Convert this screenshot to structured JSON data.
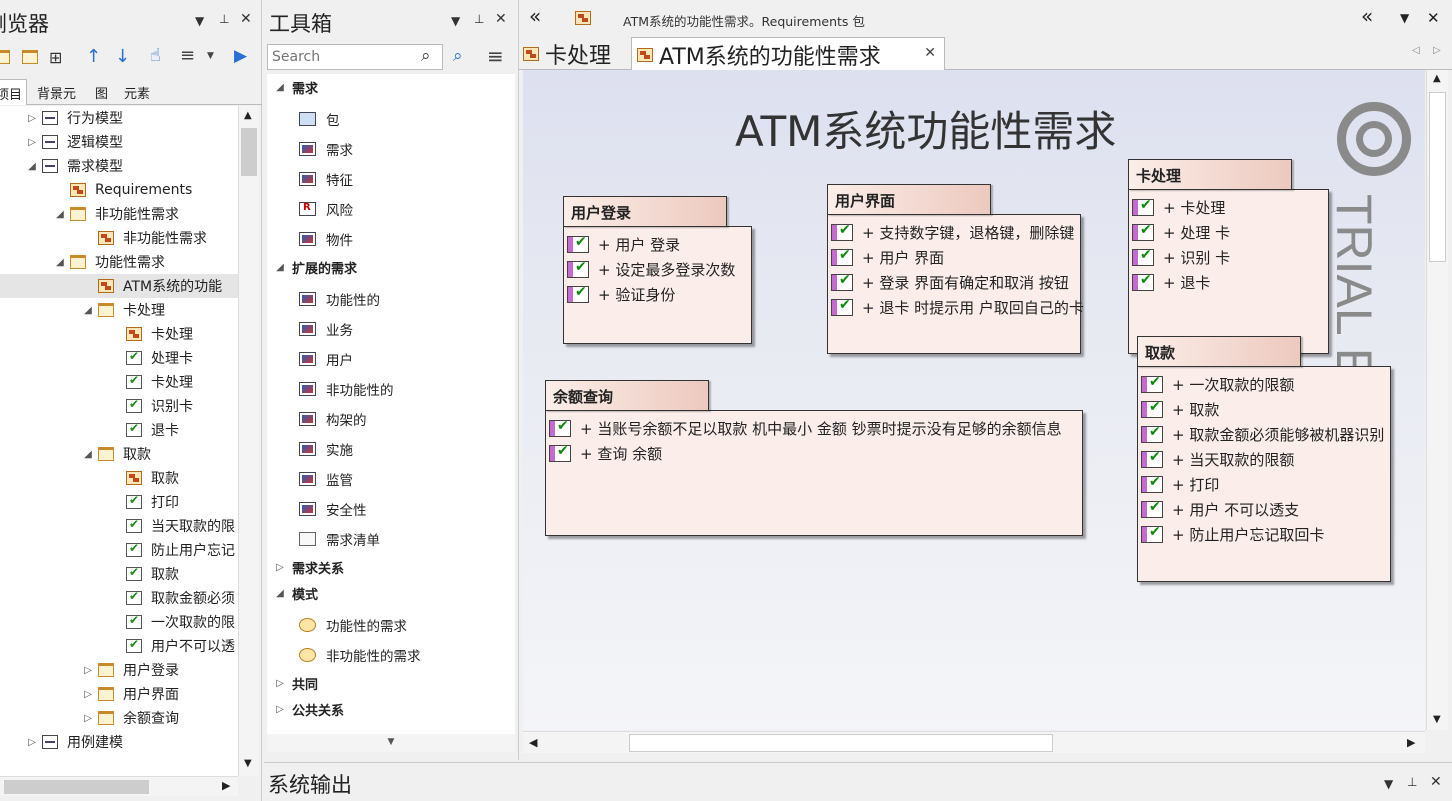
{
  "browser": {
    "title": "浏览器",
    "tabs": [
      "项目",
      "背景元",
      "图",
      "元素"
    ],
    "tree": [
      {
        "label": "行为模型",
        "level": 0,
        "icon": "pkg",
        "tw": "▷"
      },
      {
        "label": "逻辑模型",
        "level": 0,
        "icon": "pkg",
        "tw": "▷"
      },
      {
        "label": "需求模型",
        "level": 0,
        "icon": "pkg",
        "tw": "◢"
      },
      {
        "label": "Requirements",
        "level": 1,
        "icon": "diag",
        "tw": ""
      },
      {
        "label": "非功能性需求",
        "level": 1,
        "icon": "folder",
        "tw": "◢"
      },
      {
        "label": "非功能性需求",
        "level": 2,
        "icon": "diag",
        "tw": ""
      },
      {
        "label": "功能性需求",
        "level": 1,
        "icon": "folder",
        "tw": "◢"
      },
      {
        "label": "ATM系统的功能",
        "level": 2,
        "icon": "diag",
        "tw": "",
        "selected": true
      },
      {
        "label": "卡处理",
        "level": 2,
        "icon": "folder",
        "tw": "◢"
      },
      {
        "label": "卡处理",
        "level": 3,
        "icon": "diag",
        "tw": ""
      },
      {
        "label": "处理卡",
        "level": 3,
        "icon": "req",
        "tw": ""
      },
      {
        "label": "卡处理",
        "level": 3,
        "icon": "req",
        "tw": ""
      },
      {
        "label": "识别卡",
        "level": 3,
        "icon": "req",
        "tw": ""
      },
      {
        "label": "退卡",
        "level": 3,
        "icon": "req",
        "tw": ""
      },
      {
        "label": "取款",
        "level": 2,
        "icon": "folder",
        "tw": "◢"
      },
      {
        "label": "取款",
        "level": 3,
        "icon": "diag",
        "tw": ""
      },
      {
        "label": "打印",
        "level": 3,
        "icon": "req",
        "tw": ""
      },
      {
        "label": "当天取款的限",
        "level": 3,
        "icon": "req",
        "tw": ""
      },
      {
        "label": "防止用户忘记",
        "level": 3,
        "icon": "req",
        "tw": ""
      },
      {
        "label": "取款",
        "level": 3,
        "icon": "req",
        "tw": ""
      },
      {
        "label": "取款金额必须",
        "level": 3,
        "icon": "req",
        "tw": ""
      },
      {
        "label": "一次取款的限",
        "level": 3,
        "icon": "req",
        "tw": ""
      },
      {
        "label": "用户不可以透",
        "level": 3,
        "icon": "req",
        "tw": ""
      },
      {
        "label": "用户登录",
        "level": 2,
        "icon": "folder",
        "tw": "▷"
      },
      {
        "label": "用户界面",
        "level": 2,
        "icon": "folder",
        "tw": "▷"
      },
      {
        "label": "余额查询",
        "level": 2,
        "icon": "folder",
        "tw": "▷"
      },
      {
        "label": "用例建模",
        "level": 0,
        "icon": "pkg",
        "tw": "▷"
      }
    ]
  },
  "toolbox": {
    "title": "工具箱",
    "search_placeholder": "Search",
    "sections": [
      {
        "label": "需求",
        "open": true,
        "items": [
          [
            "包",
            "pkg"
          ],
          [
            "需求",
            "req"
          ],
          [
            "特征",
            "req"
          ],
          [
            "风险",
            "risk"
          ],
          [
            "物件",
            "req"
          ]
        ]
      },
      {
        "label": "扩展的需求",
        "open": true,
        "items": [
          [
            "功能性的",
            "req"
          ],
          [
            "业务",
            "req"
          ],
          [
            "用户",
            "req"
          ],
          [
            "非功能性的",
            "req"
          ],
          [
            "构架的",
            "req"
          ],
          [
            "实施",
            "req"
          ],
          [
            "监管",
            "req"
          ],
          [
            "安全性",
            "req"
          ],
          [
            "需求清单",
            "list"
          ]
        ]
      },
      {
        "label": "需求关系",
        "open": false,
        "items": []
      },
      {
        "label": "模式",
        "open": true,
        "items": [
          [
            "功能性的需求",
            "pattern"
          ],
          [
            "非功能性的需求",
            "pattern"
          ]
        ]
      },
      {
        "label": "共同",
        "open": false,
        "items": []
      },
      {
        "label": "公共关系",
        "open": false,
        "items": []
      }
    ]
  },
  "diagram": {
    "window_title": "ATM系统的功能性需求。Requirements 包",
    "tabs": [
      {
        "label": "卡处理",
        "active": false
      },
      {
        "label": "ATM系统的功能性需求",
        "active": true
      }
    ],
    "heading": "ATM系统功能性需求",
    "watermark": "TRIAL Edition",
    "boxes": [
      {
        "title": "用户登录",
        "items": [
          "+ 用户 登录",
          "+ 设定最多登录次数",
          "+ 验证身份"
        ]
      },
      {
        "title": "用户界面",
        "items": [
          "+ 支持数字键，退格键，删除键",
          "+ 用户 界面",
          "+ 登录 界面有确定和取消 按钮",
          "+ 退卡 时提示用 户取回自己的卡"
        ]
      },
      {
        "title": "卡处理",
        "items": [
          "+ 卡处理",
          "+ 处理 卡",
          "+ 识别 卡",
          "+ 退卡"
        ]
      },
      {
        "title": "余额查询",
        "items": [
          "+ 当账号余额不足以取款 机中最小 金额 钞票时提示没有足够的余额信息",
          "+ 查询 余额"
        ]
      },
      {
        "title": "取款",
        "items": [
          "+ 一次取款的限额",
          "+ 取款",
          "+ 取款金额必须能够被机器识别",
          "+ 当天取款的限额",
          "+ 打印",
          "+ 用户 不可以透支",
          "+ 防止用户忘记取回卡"
        ]
      }
    ]
  },
  "output": {
    "title": "系统输出"
  }
}
